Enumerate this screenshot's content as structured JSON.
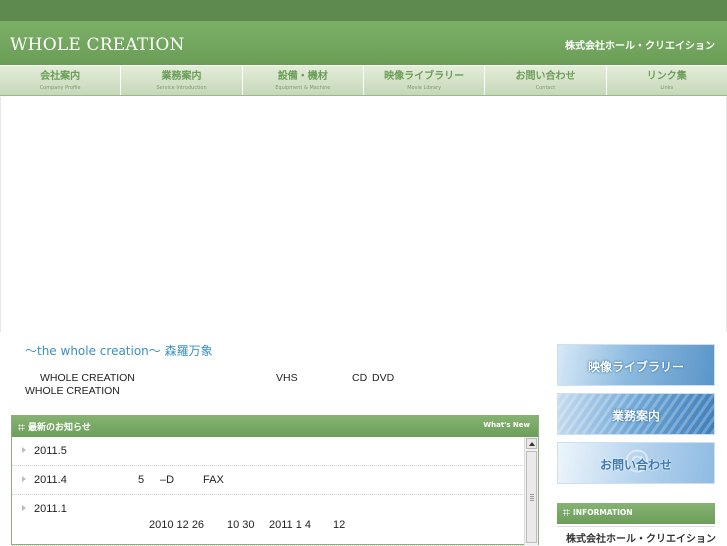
{
  "header": {
    "logo": "WHOLE CREATION",
    "company": "株式会社ホール・クリエイション"
  },
  "nav": [
    {
      "jp": "会社案内",
      "en": "Company Profile"
    },
    {
      "jp": "業務案内",
      "en": "Service Introduction"
    },
    {
      "jp": "設備・機材",
      "en": "Equipment & Machine"
    },
    {
      "jp": "映像ライブラリー",
      "en": "Movie Library"
    },
    {
      "jp": "お問い合わせ",
      "en": "Contact"
    },
    {
      "jp": "リンク集",
      "en": "Links"
    }
  ],
  "main": {
    "tagline": "〜the whole creation〜 森羅万象",
    "intro": {
      "line1_a": "WHOLE CREATION",
      "line1_b": "VHS",
      "line1_c": "CD",
      "line1_d": "DVD",
      "line2": "WHOLE CREATION"
    }
  },
  "news": {
    "title": "最新のお知らせ",
    "title_en": "What's New",
    "items": [
      {
        "date": "2011.5",
        "parts": []
      },
      {
        "date": "2011.4",
        "parts": [
          "5",
          "–D",
          "FAX"
        ]
      },
      {
        "date": "2011.1",
        "parts": [
          "2010 12 26",
          "10 30",
          "2011 1 4",
          "12"
        ]
      }
    ]
  },
  "sidebar": {
    "banners": [
      "映像ライブラリー",
      "業務案内",
      "お問い合わせ"
    ],
    "info_title": "INFORMATION",
    "info_company": "株式会社ホール・クリエイション"
  },
  "colors": {
    "header_green": "#6a9e57",
    "accent_blue": "#3a8fc3"
  }
}
